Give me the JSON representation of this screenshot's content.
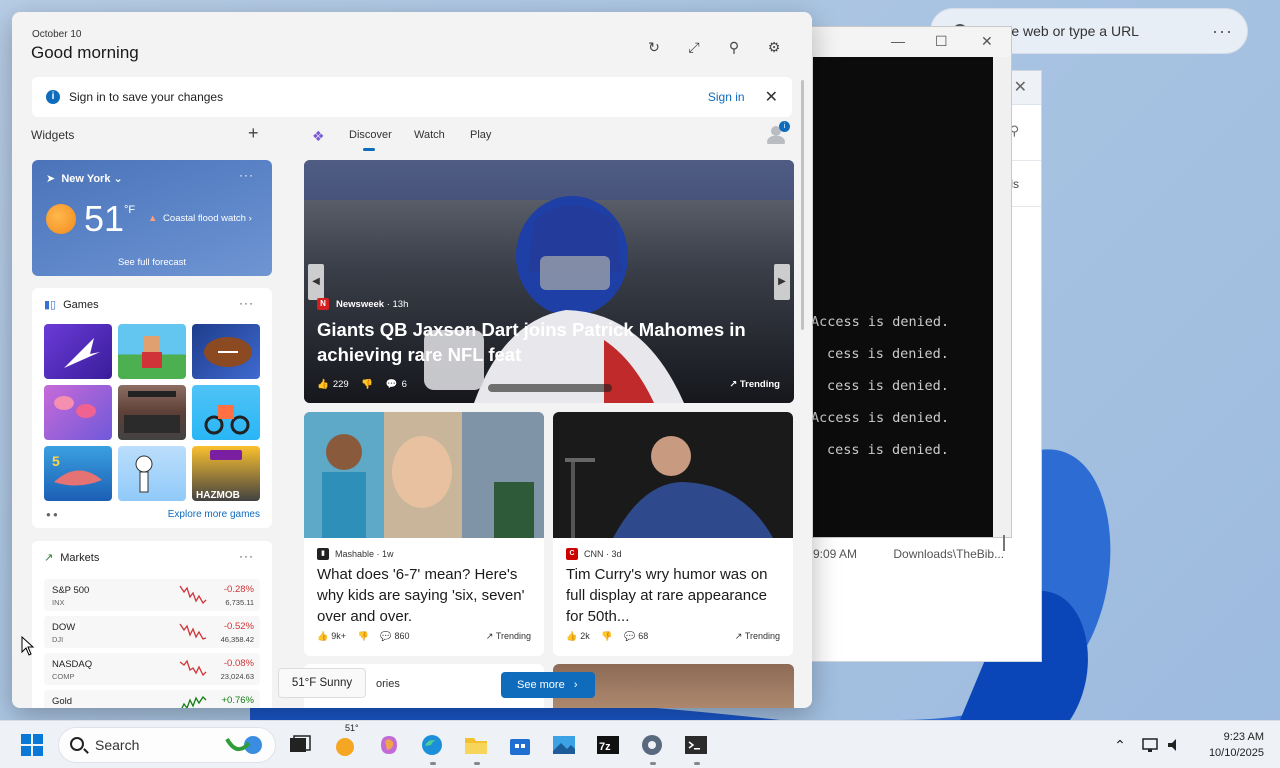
{
  "edge": {
    "address_placeholder": "Search the web or type a URL",
    "address_text": "ch the web or type a URL",
    "menu_glyph": "···"
  },
  "explorer": {
    "file_time": "9:09 AM",
    "file_path": "Downloads\\TheBib...",
    "row_text": "ls"
  },
  "terminal": {
    "lines": [
      "Access is denied.",
      "cess is denied.",
      "cess is denied.",
      "Access is denied.",
      "cess is denied."
    ]
  },
  "widgets": {
    "date": "October 10",
    "greeting": "Good morning",
    "signin_bar": {
      "message": "Sign in to save your changes",
      "link": "Sign in"
    },
    "section_title": "Widgets",
    "add_glyph": "+",
    "weather": {
      "location": "New York",
      "temperature": "51",
      "unit": "°F",
      "alert": "Coastal flood watch",
      "forecast_link": "See full forecast"
    },
    "games": {
      "title": "Games",
      "explore": "Explore more games",
      "tiles": [
        "arrow-puzzle",
        "block-runner",
        "football",
        "makeup-brushes",
        "road-racer",
        "moto-bike",
        "shark-game",
        "stickman-game",
        "playgama-hazmob"
      ]
    },
    "markets": {
      "title": "Markets",
      "rows": [
        {
          "name": "S&P 500",
          "sub": "INX",
          "change": "-0.28%",
          "value": "6,735.11",
          "trend": "down"
        },
        {
          "name": "DOW",
          "sub": "DJI",
          "change": "-0.52%",
          "value": "46,358.42",
          "trend": "down"
        },
        {
          "name": "NASDAQ",
          "sub": "COMP",
          "change": "-0.08%",
          "value": "23,024.63",
          "trend": "down"
        },
        {
          "name": "Gold",
          "sub": "",
          "change": "+0.76%",
          "value": "",
          "trend": "up"
        }
      ]
    }
  },
  "feed": {
    "tabs": [
      "Discover",
      "Watch",
      "Play"
    ],
    "active_tab": "Discover",
    "hero": {
      "source": "Newsweek",
      "age": "13h",
      "title": "Giants QB Jaxson Dart joins Patrick Mahomes in achieving rare NFL feat",
      "likes": "229",
      "comments": "6",
      "trending": "Trending"
    },
    "cards": [
      {
        "source": "Mashable",
        "age": "1w",
        "title": "What does '6-7' mean? Here's why kids are saying 'six, seven' over and over.",
        "likes": "9k+",
        "comments": "860",
        "trending": "Trending"
      },
      {
        "source": "CNN",
        "age": "3d",
        "title": "Tim Curry's wry humor was on full display at rare appearance for 50th...",
        "likes": "2k",
        "comments": "68",
        "trending": "Trending"
      }
    ],
    "bottom_card_text": "ories",
    "see_more": "See more",
    "weather_tip": "51°F Sunny"
  },
  "taskbar": {
    "search_label": "Search",
    "weather_temp": "51°",
    "time": "9:23 AM",
    "date": "10/10/2025"
  },
  "colors": {
    "accent": "#0f6cbd",
    "negative": "#d13438",
    "positive": "#107c10",
    "weather_card": "#5d86c9"
  }
}
